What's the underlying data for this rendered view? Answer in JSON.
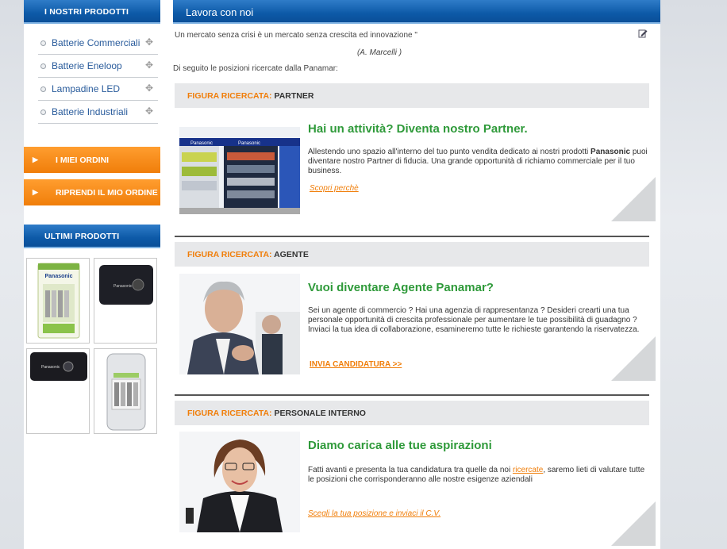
{
  "sidebar": {
    "products_title": "I NOSTRI PRODOTTI",
    "products": [
      {
        "label": "Batterie Commerciali"
      },
      {
        "label": "Batterie Eneloop"
      },
      {
        "label": "Lampadine LED"
      },
      {
        "label": "Batterie Industriali"
      }
    ],
    "orders_label": "I MIEI ORDINI",
    "resume_label": "RIPRENDI IL MIO ORDINE",
    "latest_title": "ULTIMI PRODOTTI",
    "thumb_brand": "Panasonic"
  },
  "main": {
    "title": "Lavora con noi",
    "quote": "Un mercato senza crisi è un mercato senza crescita ed innovazione \"",
    "author": "(A. Marcelli )",
    "intro": "Di seguito le posizioni ricercate dalla Panamar:",
    "section_prefix": "FIGURA RICERCATA:",
    "sections": [
      {
        "name": "PARTNER",
        "heading": "Hai un attività? Diventa nostro Partner.",
        "text_before": "Allestendo uno spazio all'interno del tuo punto vendita dedicato ai nostri prodotti ",
        "text_bold": "Panasonic",
        "text_after": " puoi diventare nostro Partner di fiducia. Una grande opportunità di richiamo commerciale per il tuo business.",
        "link": "Scopri perchè"
      },
      {
        "name": "AGENTE",
        "heading": "Vuoi diventare Agente Panamar?",
        "text": "Sei un agente di commercio ? Hai una agenzia di rappresentanza ? Desideri crearti una tua personale opportunità di crescita professionale per aumentare le tue possibilità di guadagno ? Inviaci la tua idea di collaborazione, esamineremo tutte le richieste garantendo la riservatezza.",
        "link": "INVIA CANDIDATURA >>"
      },
      {
        "name": "PERSONALE INTERNO",
        "heading": "Diamo carica alle tue aspirazioni",
        "text_before": "Fatti avanti e presenta la tua candidatura tra quelle da noi ",
        "text_link": "ricercate",
        "text_after": ", saremo lieti di valutare tutte le posizioni che corrisponderanno alle nostre esigenze aziendali",
        "link": "Scegli la tua posizione e inviaci il C.V."
      }
    ]
  },
  "colors": {
    "blue": "#0d5aa8",
    "orange": "#f07e0a",
    "green": "#2f9a3a"
  }
}
